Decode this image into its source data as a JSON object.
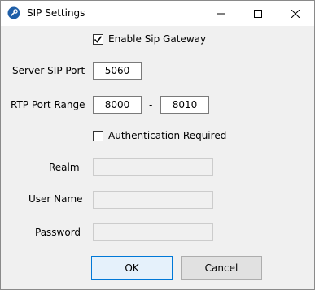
{
  "window": {
    "title": "SIP Settings",
    "app_icon": "wrench-icon"
  },
  "form": {
    "enable_gateway": {
      "label": "Enable Sip Gateway",
      "checked": true
    },
    "server_sip_port": {
      "label": "Server SIP Port",
      "value": "5060"
    },
    "rtp_port_range": {
      "label": "RTP Port Range",
      "from": "8000",
      "separator": "-",
      "to": "8010"
    },
    "auth_required": {
      "label": "Authentication Required",
      "checked": false
    },
    "realm": {
      "label": "Realm",
      "value": ""
    },
    "user_name": {
      "label": "User Name",
      "value": ""
    },
    "password": {
      "label": "Password",
      "value": ""
    }
  },
  "buttons": {
    "ok": "OK",
    "cancel": "Cancel"
  }
}
